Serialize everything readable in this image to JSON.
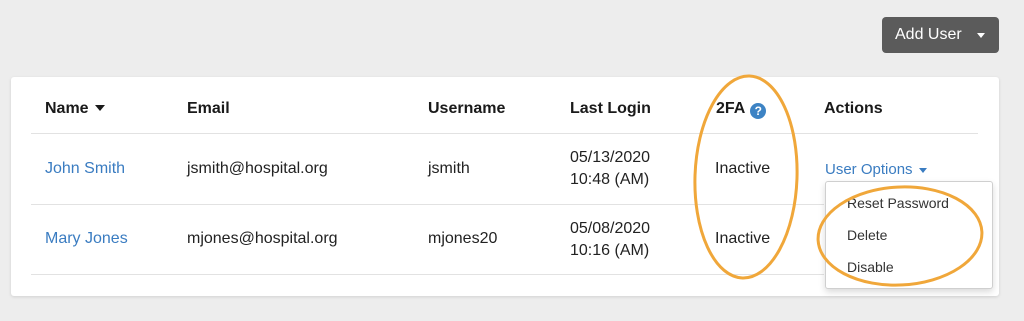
{
  "toolbar": {
    "add_user_label": "Add User"
  },
  "table": {
    "headers": {
      "name": "Name",
      "email": "Email",
      "username": "Username",
      "last_login": "Last Login",
      "twofa": "2FA",
      "actions": "Actions"
    },
    "help_glyph": "?",
    "rows": [
      {
        "name": "John Smith",
        "email": "jsmith@hospital.org",
        "username": "jsmith",
        "last_login_date": "05/13/2020",
        "last_login_time": "10:48 (AM)",
        "twofa": "Inactive"
      },
      {
        "name": "Mary Jones",
        "email": "mjones@hospital.org",
        "username": "mjones20",
        "last_login_date": "05/08/2020",
        "last_login_time": "10:16 (AM)",
        "twofa": "Inactive"
      }
    ]
  },
  "actions": {
    "user_options_label": "User Options",
    "menu": [
      "Reset Password",
      "Delete",
      "Disable"
    ]
  },
  "colors": {
    "link": "#3a7cc1",
    "highlight": "#f0a73a",
    "button_bg": "#5b5b5b",
    "help_icon": "#3d83c4"
  },
  "icons": [
    "caret-down-icon",
    "sort-desc-icon",
    "help-circle-icon"
  ]
}
